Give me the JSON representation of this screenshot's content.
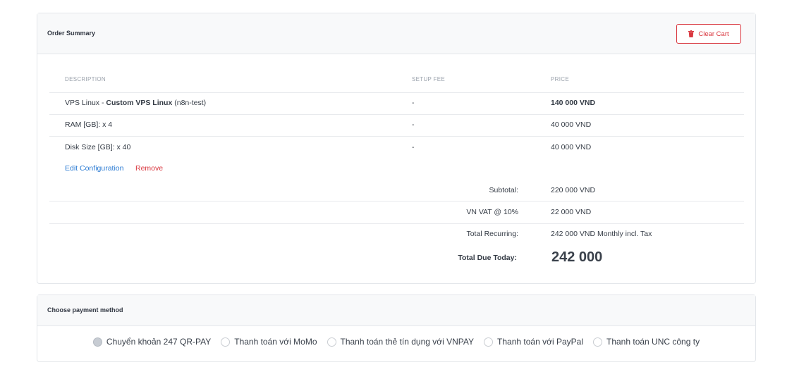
{
  "order": {
    "title": "Order Summary",
    "clear_cart": "Clear Cart",
    "columns": {
      "description": "DESCRIPTION",
      "setup_fee": "SETUP FEE",
      "price": "PRICE"
    },
    "item": {
      "product_prefix": "VPS Linux - ",
      "product_name": "Custom VPS Linux",
      "product_suffix": " (n8n-test)",
      "setup_fee": "-",
      "price": "140 000 VND"
    },
    "options": [
      {
        "label": "RAM [GB]: x 4",
        "setup_fee": "-",
        "price": "40 000 VND"
      },
      {
        "label": "Disk Size [GB]: x 40",
        "setup_fee": "-",
        "price": "40 000 VND"
      }
    ],
    "edit_configuration": "Edit Configuration",
    "remove": "Remove",
    "subtotal_label": "Subtotal:",
    "subtotal_value": "220 000 VND",
    "vat_label": "VN VAT @ 10%",
    "vat_value": "22 000 VND",
    "recurring_label": "Total Recurring:",
    "recurring_value": "242 000 VND Monthly incl. Tax",
    "due_label": "Total Due Today:",
    "due_value": "242 000"
  },
  "payment": {
    "title": "Choose payment method",
    "methods": [
      {
        "label": "Chuyển khoản 247 QR-PAY",
        "selected": true
      },
      {
        "label": "Thanh toán với MoMo",
        "selected": false
      },
      {
        "label": "Thanh toán thẻ tín dụng với VNPAY",
        "selected": false
      },
      {
        "label": "Thanh toán với PayPal",
        "selected": false
      },
      {
        "label": "Thanh toán UNC công ty",
        "selected": false
      }
    ]
  },
  "colors": {
    "danger": "#d9363e",
    "link": "#2b7bd3"
  },
  "icons": {
    "clear_cart": "trash-icon"
  }
}
